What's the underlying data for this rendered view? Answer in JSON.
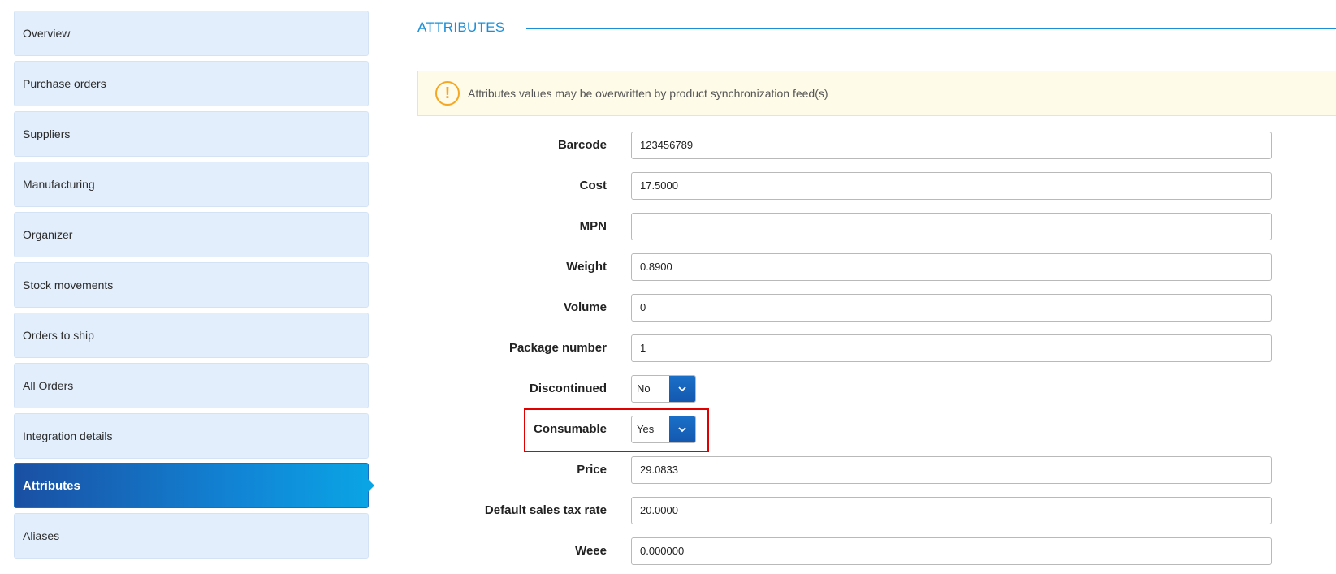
{
  "sidebar": {
    "items": [
      {
        "label": "Overview"
      },
      {
        "label": "Purchase orders"
      },
      {
        "label": "Suppliers"
      },
      {
        "label": "Manufacturing"
      },
      {
        "label": "Organizer"
      },
      {
        "label": "Stock movements"
      },
      {
        "label": "Orders to ship"
      },
      {
        "label": "All Orders"
      },
      {
        "label": "Integration details"
      },
      {
        "label": "Attributes"
      },
      {
        "label": "Aliases"
      }
    ],
    "active": "Attributes"
  },
  "main": {
    "section_title": "ATTRIBUTES",
    "notice": {
      "icon": "exclamation-circle-icon",
      "text": "Attributes values may be overwritten by product synchronization feed(s)"
    },
    "fields": {
      "barcode": {
        "label": "Barcode",
        "value": "123456789"
      },
      "cost": {
        "label": "Cost",
        "value": "17.5000"
      },
      "mpn": {
        "label": "MPN",
        "value": ""
      },
      "weight": {
        "label": "Weight",
        "value": "0.8900"
      },
      "volume": {
        "label": "Volume",
        "value": "0"
      },
      "package_number": {
        "label": "Package number",
        "value": "1"
      },
      "discontinued": {
        "label": "Discontinued",
        "value": "No"
      },
      "consumable": {
        "label": "Consumable",
        "value": "Yes"
      },
      "price": {
        "label": "Price",
        "value": "29.0833"
      },
      "default_sales_tax_rate": {
        "label": "Default sales tax rate",
        "value": "20.0000"
      },
      "weee": {
        "label": "Weee",
        "value": "0.000000"
      }
    }
  },
  "colors": {
    "accent": "#1a8fd8",
    "sidebar_bg": "#e2eefc",
    "active_gradient_start": "#1a4fa3",
    "active_gradient_end": "#0aa4e4",
    "notice_bg": "#fefbe8",
    "warning_icon": "#f5a623",
    "highlight_border": "#e00000"
  }
}
